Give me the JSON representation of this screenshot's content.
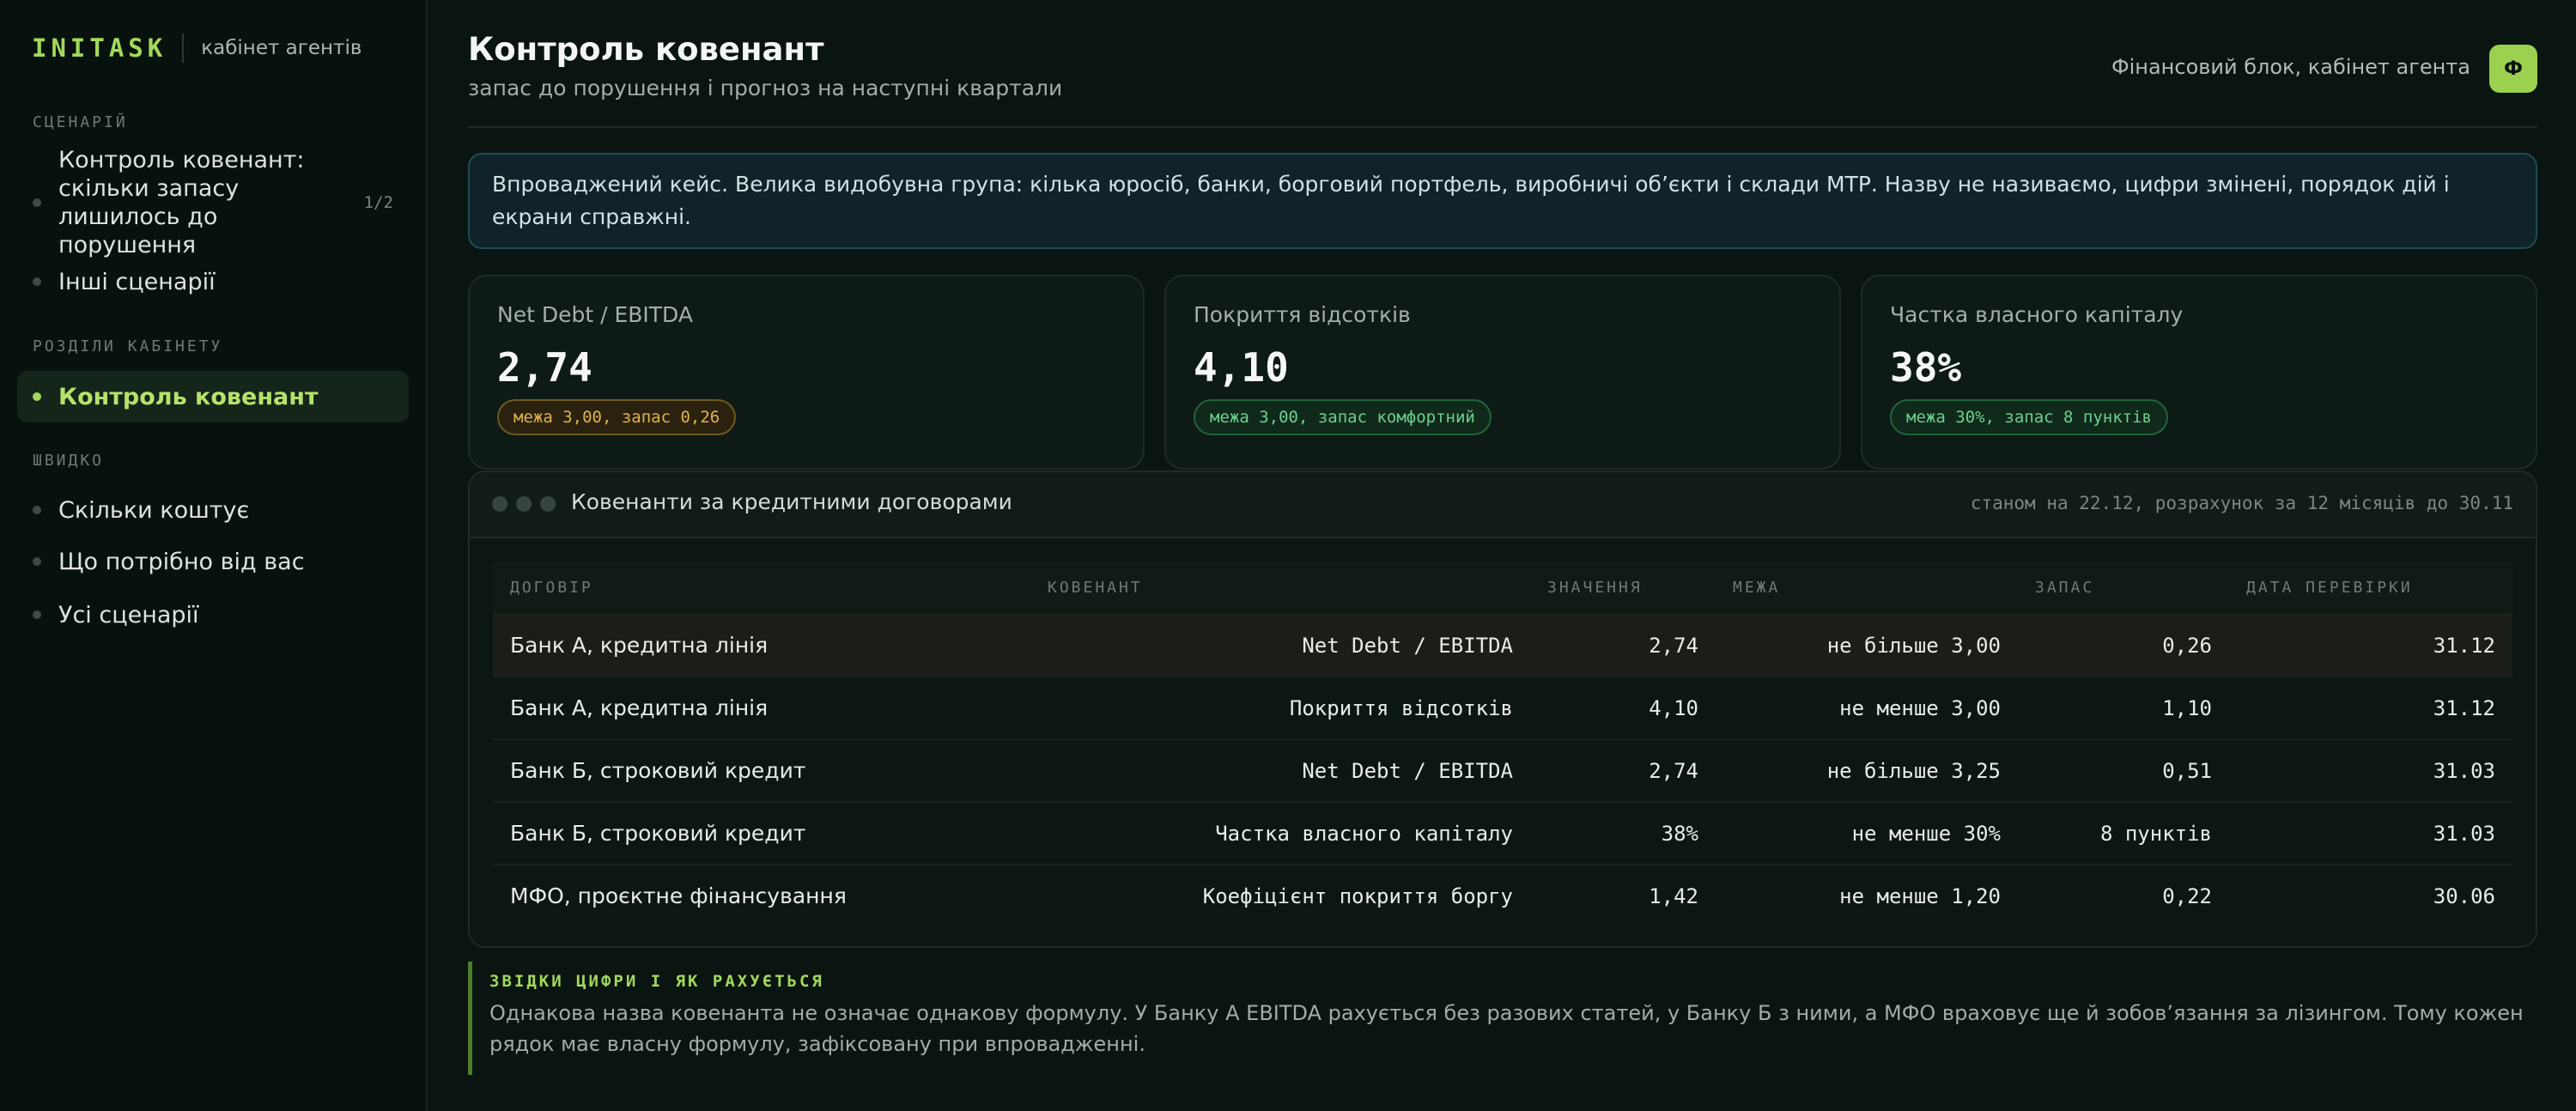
{
  "brand": {
    "logo": "INITASK",
    "subtitle": "кабінет агентів"
  },
  "sidebar": {
    "section_scenario": "СЦЕНАРІЙ",
    "scenario_items": [
      {
        "label": "Контроль ковенант: скільки запасу лишилось до порушення",
        "count": "1/2"
      },
      {
        "label": "Інші сценарії"
      }
    ],
    "section_cabinet": "РОЗДІЛИ КАБІНЕТУ",
    "cabinet_items": [
      {
        "label": "Контроль ковенант"
      }
    ],
    "section_quick": "ШВИДКО",
    "quick_items": [
      {
        "label": "Скільки коштує"
      },
      {
        "label": "Що потрібно від вас"
      },
      {
        "label": "Усі сценарії"
      }
    ]
  },
  "header": {
    "title": "Контроль ковенант",
    "subtitle": "запас до порушення і прогноз на наступні квартали",
    "user_label": "Фінансовий блок, кабінет агента",
    "avatar_letter": "Ф"
  },
  "notice": "Впроваджений кейс. Велика видобувна група: кілька юросіб, банки, борговий портфель, виробничі об’єкти і склади МТР. Назву не називаємо, цифри змінені, порядок дій і екрани справжні.",
  "kpis": [
    {
      "label": "Net Debt / EBITDA",
      "value": "2,74",
      "pill": "межа 3,00, запас 0,26"
    },
    {
      "label": "Покриття відсотків",
      "value": "4,10",
      "pill": "межа 3,00, запас комфортний"
    },
    {
      "label": "Частка власного капіталу",
      "value": "38%",
      "pill": "межа 30%, запас 8 пунктів"
    }
  ],
  "table": {
    "title": "Ковенанти за кредитними договорами",
    "meta": "станом на 22.12, розрахунок за 12 місяців до 30.11",
    "columns": [
      "ДОГОВІР",
      "КОВЕНАНТ",
      "ЗНАЧЕННЯ",
      "МЕЖА",
      "ЗАПАС",
      "ДАТА ПЕРЕВІРКИ"
    ],
    "rows": [
      [
        "Банк А, кредитна лінія",
        "Net Debt / EBITDA",
        "2,74",
        "не більше 3,00",
        "0,26",
        "31.12"
      ],
      [
        "Банк А, кредитна лінія",
        "Покриття відсотків",
        "4,10",
        "не менше 3,00",
        "1,10",
        "31.12"
      ],
      [
        "Банк Б, строковий кредит",
        "Net Debt / EBITDA",
        "2,74",
        "не більше 3,25",
        "0,51",
        "31.03"
      ],
      [
        "Банк Б, строковий кредит",
        "Частка власного капіталу",
        "38%",
        "не менше 30%",
        "8 пунктів",
        "31.03"
      ],
      [
        "МФО, проєктне фінансування",
        "Коефіцієнт покриття боргу",
        "1,42",
        "не менше 1,20",
        "0,22",
        "30.06"
      ]
    ]
  },
  "note": {
    "title": "ЗВІДКИ ЦИФРИ І ЯК РАХУЄТЬСЯ",
    "text": "Однакова назва ковенанта не означає однакову формулу. У Банку А EBITDA рахується без разових статей, у Банку Б з ними, а МФО враховує ще й зобов’язання за лізингом. Тому кожен рядок має власну формулу, зафіксовану при впровадженні."
  },
  "colors": {
    "accent": "#a3d95b",
    "warning": "#e0b349",
    "ok": "#6ecf8c",
    "background": "#0a1410"
  }
}
